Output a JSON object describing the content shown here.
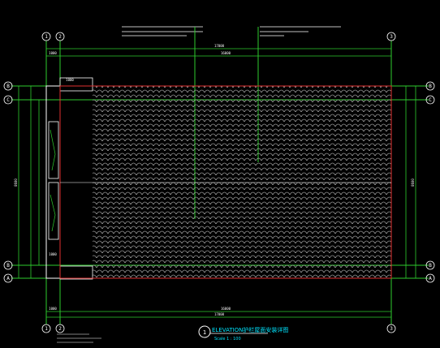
{
  "drawing": {
    "axes_top": [
      "1",
      "2",
      "3"
    ],
    "axes_bottom": [
      "1",
      "2",
      "3"
    ],
    "axes_left": [
      "B",
      "C",
      "B",
      "A"
    ],
    "axes_right": [
      "B",
      "C",
      "B",
      "A"
    ],
    "dims": {
      "overall_top": "17000",
      "left_part_top": "1000",
      "main_top": "16000",
      "overall_bottom": "17000",
      "left_part_bottom": "1000",
      "main_bottom": "16000",
      "panel_width": "1000",
      "left_vertical_total": "8600",
      "right_vertical_total": "8600",
      "bottom_panel_small": "1000"
    },
    "title": {
      "number": "1",
      "text": "ELEVATION护栏屋面安装详图",
      "scale": "Scale 1 : 100"
    },
    "colors": {
      "background": "#000000",
      "grid_line": "#2ecc2e",
      "tile_edge": "#e03030",
      "tile_pattern": "#ffffff",
      "title": "#00e5ff"
    }
  }
}
